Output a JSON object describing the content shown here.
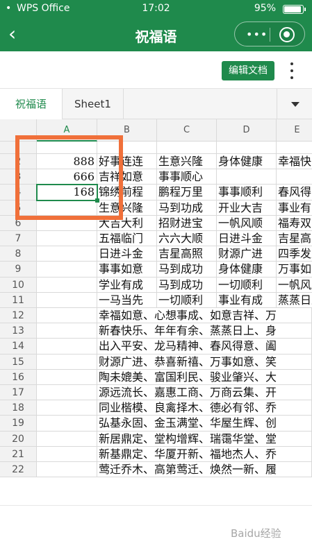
{
  "status_bar": {
    "carrier": "WPS Office",
    "time": "17:02",
    "battery": "95%"
  },
  "nav": {
    "back_icon": "‹",
    "title": "祝福语",
    "more_icon": "•••"
  },
  "toolbar": {
    "edit_label": "编辑文档"
  },
  "tabs": [
    "祝福语",
    "Sheet1"
  ],
  "sheet": {
    "columns": [
      "A",
      "B",
      "C",
      "D",
      "E"
    ],
    "rows": [
      {
        "num": "2",
        "a": "888",
        "b": "好事连连",
        "c": "生意兴隆",
        "d": "身体健康",
        "e": "幸福快"
      },
      {
        "num": "3",
        "a": "666",
        "b": "吉祥如意",
        "c": "事事顺心",
        "d": "",
        "e": ""
      },
      {
        "num": "4",
        "a": "168",
        "b": "锦绣前程",
        "c": "鹏程万里",
        "d": "事事顺利",
        "e": "春风得"
      },
      {
        "num": "5",
        "a": "",
        "b": "生意兴隆",
        "c": "马到功成",
        "d": "开业大吉",
        "e": "事业有"
      },
      {
        "num": "6",
        "a": "",
        "b": "大吉大利",
        "c": "招财进宝",
        "d": "一帆风顺",
        "e": "福寿双"
      },
      {
        "num": "7",
        "a": "",
        "b": "五福临门",
        "c": "六六大顺",
        "d": "日进斗金",
        "e": "吉星高"
      },
      {
        "num": "8",
        "a": "",
        "b": "日进斗金",
        "c": "吉星高照",
        "d": "财源广进",
        "e": "四季发财"
      },
      {
        "num": "9",
        "a": "",
        "b": "事事如意",
        "c": "马到成功",
        "d": "身体健康",
        "e": "万事如意"
      },
      {
        "num": "10",
        "a": "",
        "b": "学业有成",
        "c": "马到成功",
        "d": "一切顺利",
        "e": "一帆风顺"
      },
      {
        "num": "11",
        "a": "",
        "b": "一马当先",
        "c": "一切顺利",
        "d": "事业有成",
        "e": "蒸蒸日上"
      },
      {
        "num": "12",
        "a": "",
        "b": "幸福如意、心想事成、如意吉祥、万",
        "c": "",
        "d": "",
        "e": ""
      },
      {
        "num": "13",
        "a": "",
        "b": "新春快乐、年年有余、蒸蒸日上、身",
        "c": "",
        "d": "",
        "e": ""
      },
      {
        "num": "14",
        "a": "",
        "b": "出入平安、龙马精神、春风得意、阖",
        "c": "",
        "d": "",
        "e": ""
      },
      {
        "num": "15",
        "a": "",
        "b": "财源广进、恭喜新禧、万事如意、笑",
        "c": "",
        "d": "",
        "e": ""
      },
      {
        "num": "16",
        "a": "",
        "b": "陶未媲美、富国利民、骏业肇兴、大",
        "c": "",
        "d": "",
        "e": ""
      },
      {
        "num": "17",
        "a": "",
        "b": "源远流长、嘉惠工商、万商云集、开",
        "c": "",
        "d": "",
        "e": ""
      },
      {
        "num": "18",
        "a": "",
        "b": "同业楷模、良禽择木、德必有邻、乔",
        "c": "",
        "d": "",
        "e": ""
      },
      {
        "num": "19",
        "a": "",
        "b": "弘基永固、金玉满堂、华屋生辉、创",
        "c": "",
        "d": "",
        "e": ""
      },
      {
        "num": "20",
        "a": "",
        "b": "新居鼎定、堂构增辉、瑞霭华堂、堂",
        "c": "",
        "d": "",
        "e": ""
      },
      {
        "num": "21",
        "a": "",
        "b": "新基鼎定、华厦开新、福地杰人、乔",
        "c": "",
        "d": "",
        "e": ""
      },
      {
        "num": "22",
        "a": "",
        "b": "莺迁乔木、高第莺迁、焕然一新、履",
        "c": "",
        "d": "",
        "e": ""
      }
    ]
  },
  "watermark": "Baidu经验",
  "colors": {
    "brand_green": "#1f8a4c",
    "highlight_orange": "#f0703a"
  }
}
